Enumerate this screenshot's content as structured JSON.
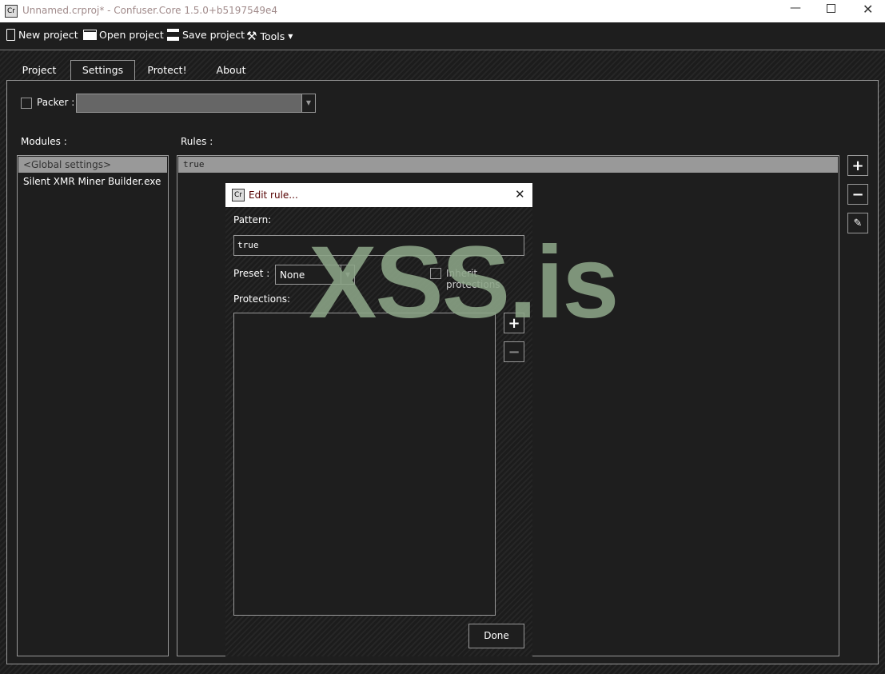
{
  "window": {
    "title": "Unnamed.crproj* - Confuser.Core 1.5.0+b5197549e4",
    "app_icon": "Cr"
  },
  "toolbar": {
    "new": "New project",
    "open": "Open project",
    "save": "Save project",
    "tools": "Tools"
  },
  "tabs": [
    "Project",
    "Settings",
    "Protect!",
    "About"
  ],
  "settings": {
    "packer_label": "Packer :",
    "packer_value": "",
    "modules_label": "Modules :",
    "rules_label": "Rules :",
    "modules": [
      "<Global settings>",
      "Silent XMR Miner Builder.exe"
    ],
    "rules": [
      "true"
    ]
  },
  "dialog": {
    "title": "Edit rule...",
    "pattern_label": "Pattern:",
    "pattern_value": "true",
    "preset_label": "Preset :",
    "preset_value": "None",
    "inherit_label": "Inherit protections",
    "protections_label": "Protections:",
    "done": "Done"
  },
  "watermark": "XSS.is"
}
